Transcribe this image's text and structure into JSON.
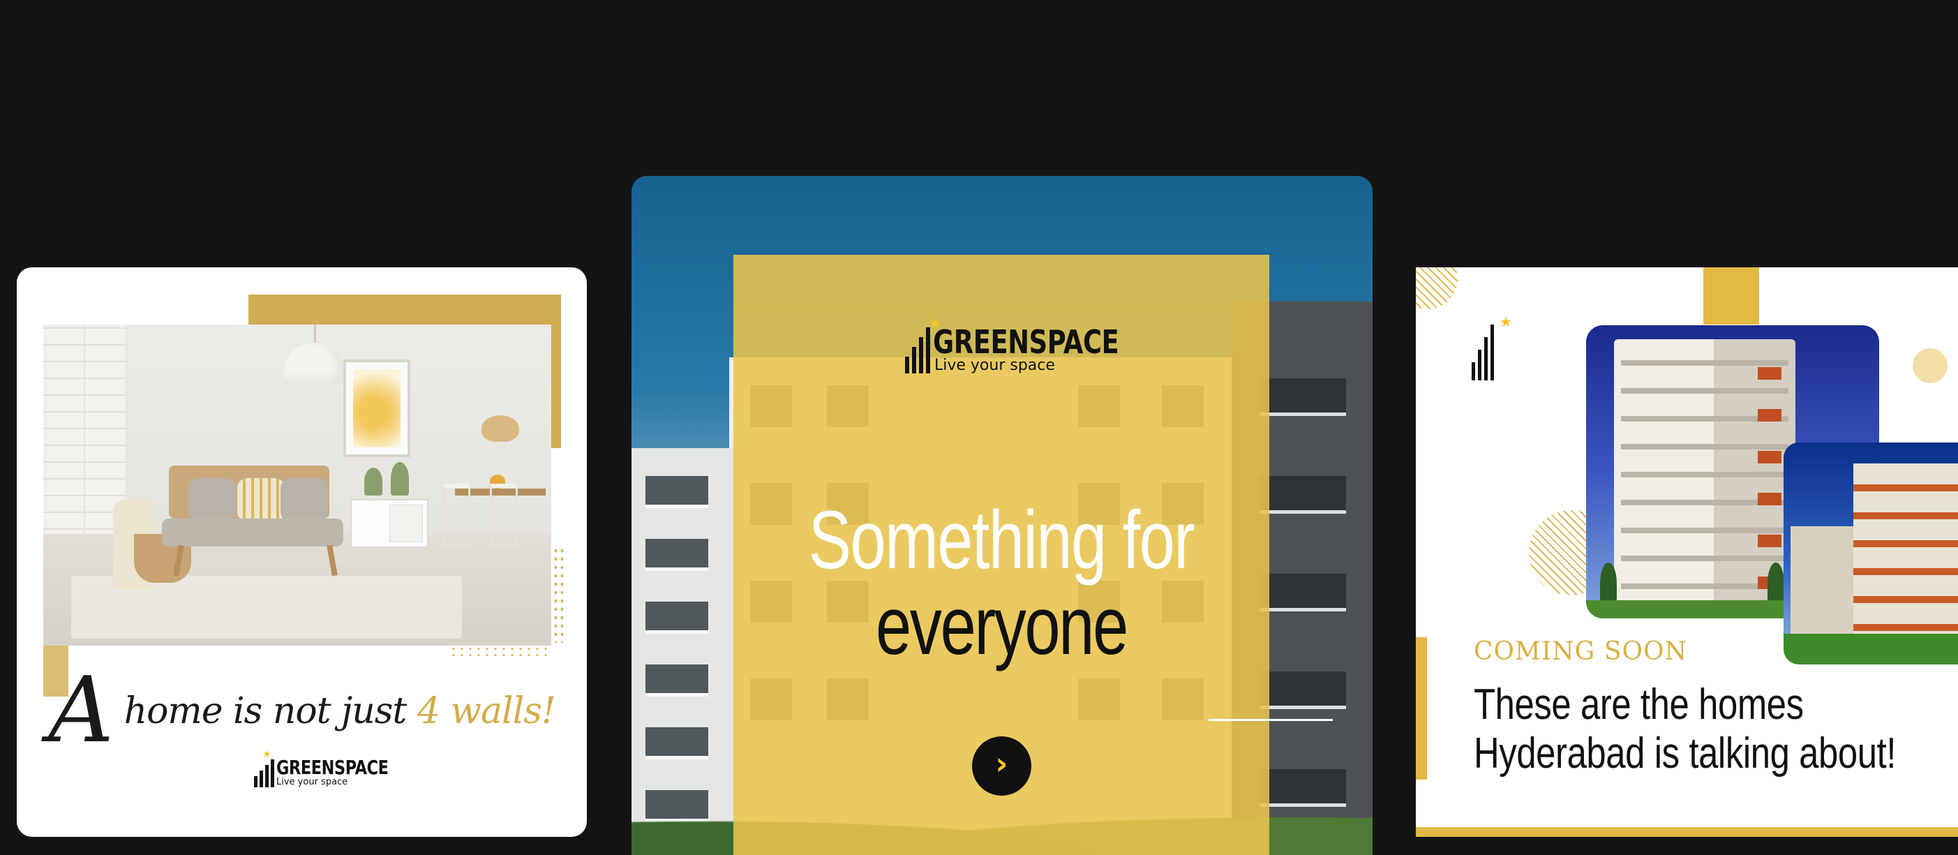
{
  "slides": {
    "slide1": {
      "tagline_lead": "A",
      "tagline_mid": "home is not just",
      "tagline_accent": "4 walls!",
      "logo": {
        "brand": "GREENSPACE",
        "sub": "Live your space"
      }
    },
    "slide2": {
      "logo": {
        "brand": "GREENSPACE",
        "sub": "Live your space"
      },
      "headline_line1": "Something for",
      "headline_line2": "everyone",
      "next_icon": "chevron-right-icon",
      "next_glyph": "›"
    },
    "slide3": {
      "eyebrow": "COMING SOON",
      "headline_line1": "These are the homes",
      "headline_line2": "Hyderabad is talking about!"
    }
  },
  "colors": {
    "background": "#141414",
    "gold": "#e2b945",
    "overlay": "#e8c44c",
    "dark": "#111111"
  }
}
